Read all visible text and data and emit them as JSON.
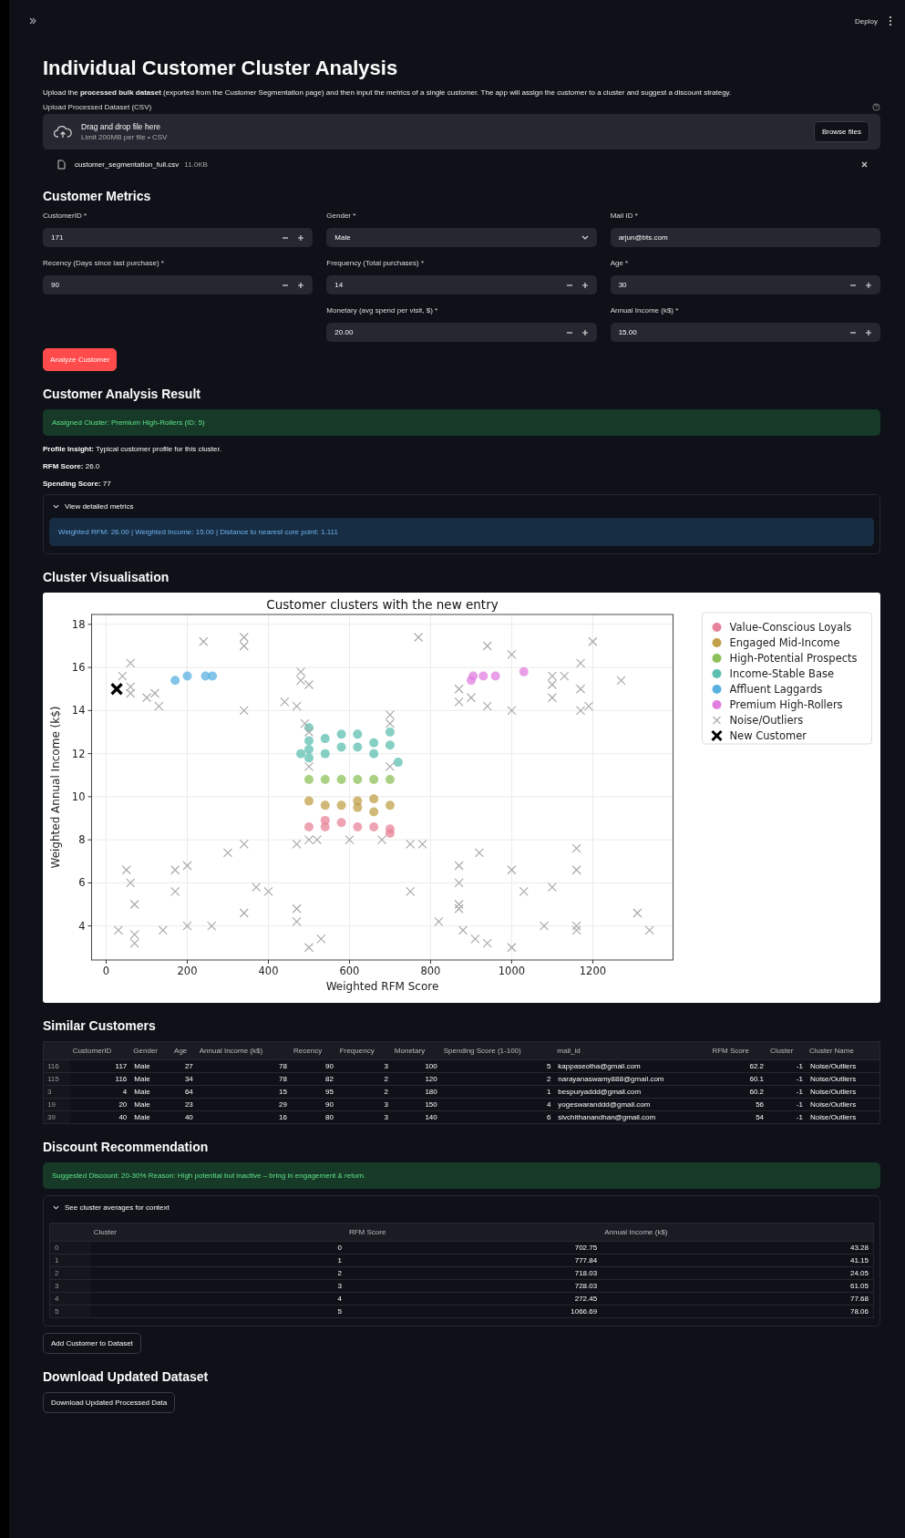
{
  "toolbar": {
    "deploy": "Deploy"
  },
  "title": "Individual Customer Cluster Analysis",
  "intro": "Upload the **processed bulk dataset** (exported from the Customer Segmentation page) and then input the metrics of a single customer. The app will assign the customer to a cluster and suggest a discount strategy.",
  "uploader": {
    "label": "Upload Processed Dataset (CSV)",
    "drop_text": "Drag and drop file here",
    "limit": "Limit 200MB per file • CSV",
    "button": "Browse files",
    "file_name": "customer_segmentation_full.csv",
    "file_size": "11.0KB"
  },
  "metrics": {
    "heading": "Customer Metrics",
    "columns": [
      [
        {
          "label": "CustomerID *",
          "value": "171",
          "kind": "number"
        },
        {
          "label": "Recency (Days since last purchase) *",
          "value": "90",
          "kind": "number"
        }
      ],
      [
        {
          "label": "Gender *",
          "value": "Male",
          "kind": "select"
        },
        {
          "label": "Frequency (Total purchases) *",
          "value": "14",
          "kind": "number"
        },
        {
          "label": "Monetary (avg spend per visit, $) *",
          "value": "20.00",
          "kind": "number"
        }
      ],
      [
        {
          "label": "Mail ID *",
          "value": "arjun@bts.com",
          "kind": "text"
        },
        {
          "label": "Age *",
          "value": "30",
          "kind": "number"
        },
        {
          "label": "Annual Income (k$) *",
          "value": "15.00",
          "kind": "number"
        }
      ]
    ],
    "button": "Analyze Customer"
  },
  "result": {
    "heading": "Customer Analysis Result",
    "alert": "Assigned Cluster: Premium High-Rollers (ID: 5)",
    "lines": [
      "**Profile Insight:** Typical customer profile for this cluster.",
      "**RFM Score:** 26.0",
      "**Spending Score:** 77"
    ],
    "expander": {
      "label": "View detailed metrics",
      "expanded": true,
      "info": "Weighted RFM: 26.00 | Weighted Income: 15.00 | Distance to nearest core point: 1.111"
    }
  },
  "visualisation": {
    "heading": "Cluster Visualisation",
    "chart_data": {
      "type": "scatter",
      "grid": true,
      "legend": true,
      "title": "Customer clusters with the new entry",
      "xlabel": "Weighted RFM Score",
      "ylabel": "Weighted Annual Income (k$)",
      "xlim": [
        -36,
        1398
      ],
      "ylim": [
        2.42,
        18.46
      ],
      "xticks": [
        0,
        200,
        400,
        600,
        800,
        1000,
        1200
      ],
      "yticks": [
        4,
        6,
        8,
        10,
        12,
        14,
        16,
        18
      ],
      "series": [
        {
          "name": "Value-Conscious Loyals",
          "color": "#e8849a",
          "marker": "circle",
          "x": [
            500,
            540,
            540,
            580,
            620,
            660,
            700,
            700
          ],
          "values": [
            8.6,
            8.6,
            8.9,
            8.8,
            8.6,
            8.6,
            8.5,
            8.3
          ]
        },
        {
          "name": "Engaged Mid-Income",
          "color": "#c0a04a",
          "marker": "circle",
          "x": [
            500,
            540,
            580,
            620,
            620,
            660,
            660,
            700
          ],
          "values": [
            9.8,
            9.6,
            9.6,
            9.8,
            9.5,
            9.9,
            9.3,
            9.6
          ]
        },
        {
          "name": "High-Potential Prospects",
          "color": "#8ec05a",
          "marker": "circle",
          "x": [
            500,
            540,
            580,
            620,
            660,
            700
          ],
          "values": [
            10.8,
            10.8,
            10.8,
            10.8,
            10.8,
            10.8
          ]
        },
        {
          "name": "Income-Stable Base",
          "color": "#5cbfb0",
          "marker": "circle",
          "x": [
            480,
            500,
            500,
            500,
            500,
            540,
            540,
            580,
            580,
            620,
            620,
            660,
            660,
            700,
            700,
            720
          ],
          "values": [
            12,
            13.2,
            12.6,
            12.2,
            11.8,
            12.7,
            12,
            12.9,
            12.3,
            12.9,
            12.3,
            12.5,
            12,
            13,
            12.4,
            11.6
          ]
        },
        {
          "name": "Affluent Laggards",
          "color": "#5ab0e0",
          "marker": "circle",
          "x": [
            170,
            200,
            245,
            262
          ],
          "values": [
            15.4,
            15.6,
            15.6,
            15.6
          ]
        },
        {
          "name": "Premium High-Rollers",
          "color": "#e07fe0",
          "marker": "circle",
          "x": [
            900,
            905,
            930,
            960,
            1030
          ],
          "values": [
            15.4,
            15.6,
            15.6,
            15.6,
            15.8
          ]
        },
        {
          "name": "Noise/Outliers",
          "color": "#aaaaaa",
          "marker": "x",
          "x": [
            40,
            60,
            60,
            60,
            100,
            120,
            130,
            240,
            340,
            340,
            340,
            440,
            470,
            480,
            480,
            500,
            490,
            500,
            700,
            700,
            700,
            500,
            770,
            870,
            870,
            900,
            940,
            940,
            1000,
            1000,
            1100,
            1100,
            1100,
            1130,
            1170,
            1170,
            1170,
            1190,
            1200,
            1270,
            1160,
            1160,
            1160,
            1160,
            1080,
            1100,
            1030,
            1000,
            1000,
            940,
            910,
            880,
            870,
            870,
            870,
            870,
            920,
            820,
            750,
            750,
            780,
            680,
            600,
            520,
            500,
            500,
            530,
            470,
            470,
            470,
            400,
            370,
            340,
            340,
            300,
            260,
            200,
            200,
            170,
            170,
            140,
            70,
            60,
            50,
            30,
            70,
            70,
            1310,
            1340
          ],
          "values": [
            15.6,
            14.8,
            15.1,
            16.2,
            14.6,
            14.8,
            14.2,
            17.2,
            17.4,
            17,
            14,
            14.4,
            14.2,
            15.8,
            15.4,
            15.2,
            13.4,
            13,
            13.8,
            13.4,
            11.4,
            11.4,
            17.4,
            14.4,
            15,
            14.6,
            17,
            14.2,
            14,
            16.6,
            14.6,
            15.2,
            15.6,
            15.6,
            16.2,
            15,
            14,
            14.2,
            17.2,
            15.4,
            7.6,
            6.6,
            4,
            3.8,
            4,
            5.8,
            5.6,
            6.6,
            3,
            3.2,
            3.4,
            3.8,
            4.8,
            5,
            6,
            6.8,
            7.4,
            4.2,
            5.6,
            7.8,
            7.8,
            8,
            8,
            8,
            8,
            3,
            3.4,
            4.8,
            4.2,
            7.8,
            5.6,
            5.8,
            7.8,
            4.6,
            7.4,
            4,
            6.8,
            4,
            6.6,
            5.6,
            3.8,
            5,
            6,
            6.6,
            3.8,
            3.6,
            3.2,
            4.6,
            3.8
          ]
        },
        {
          "name": "New Customer",
          "color": "#000000",
          "marker": "X",
          "x": [
            26
          ],
          "values": [
            15
          ]
        }
      ]
    }
  },
  "similar": {
    "heading": "Similar Customers",
    "columns": [
      "CustomerID",
      "Gender",
      "Age",
      "Annual Income (k$)",
      "Recency",
      "Frequency",
      "Monetary",
      "Spending Score (1-100)",
      "mail_id",
      "RFM Score",
      "Cluster",
      "Cluster Name"
    ],
    "rows": [
      {
        "index": "116",
        "cells": [
          "117",
          "Male",
          "27",
          "78",
          "90",
          "3",
          "100",
          "5",
          "kappaseotha@gmail.com",
          "62.2",
          "-1",
          "Noise/Outliers"
        ]
      },
      {
        "index": "115",
        "cells": [
          "116",
          "Male",
          "34",
          "78",
          "82",
          "2",
          "120",
          "2",
          "narayanaswamy888@gmail.com",
          "60.1",
          "-1",
          "Noise/Outliers"
        ]
      },
      {
        "index": "3",
        "cells": [
          "4",
          "Male",
          "64",
          "15",
          "95",
          "2",
          "180",
          "1",
          "bespuryaddd@gmail.com",
          "60.2",
          "-1",
          "Noise/Outliers"
        ]
      },
      {
        "index": "19",
        "cells": [
          "20",
          "Male",
          "23",
          "29",
          "90",
          "3",
          "150",
          "4",
          "yogeswaranddd@gmail.com",
          "56",
          "-1",
          "Noise/Outliers"
        ]
      },
      {
        "index": "39",
        "cells": [
          "40",
          "Male",
          "40",
          "16",
          "80",
          "3",
          "140",
          "6",
          "sivchithanandhan@gmail.com",
          "54",
          "-1",
          "Noise/Outliers"
        ]
      }
    ]
  },
  "discount": {
    "heading": "Discount Recommendation",
    "alert": "Suggested Discount: 20-30% Reason: High potential but inactive – bring in engagement & return.",
    "expander": {
      "label": "See cluster averages for context",
      "expanded": true
    },
    "averages": {
      "columns": [
        "Cluster",
        "RFM Score",
        "Annual Income (k$)"
      ],
      "rows": [
        {
          "index": "0",
          "cells": [
            "0",
            "702.75",
            "43.28"
          ]
        },
        {
          "index": "1",
          "cells": [
            "1",
            "777.84",
            "41.15"
          ]
        },
        {
          "index": "2",
          "cells": [
            "2",
            "718.03",
            "24.05"
          ]
        },
        {
          "index": "3",
          "cells": [
            "3",
            "728.03",
            "61.05"
          ]
        },
        {
          "index": "4",
          "cells": [
            "4",
            "272.45",
            "77.68"
          ]
        },
        {
          "index": "5",
          "cells": [
            "5",
            "1066.69",
            "78.06"
          ]
        }
      ]
    },
    "add_button": "Add Customer to Dataset"
  },
  "download": {
    "heading": "Download Updated Dataset",
    "button": "Download Updated Processed Data"
  }
}
